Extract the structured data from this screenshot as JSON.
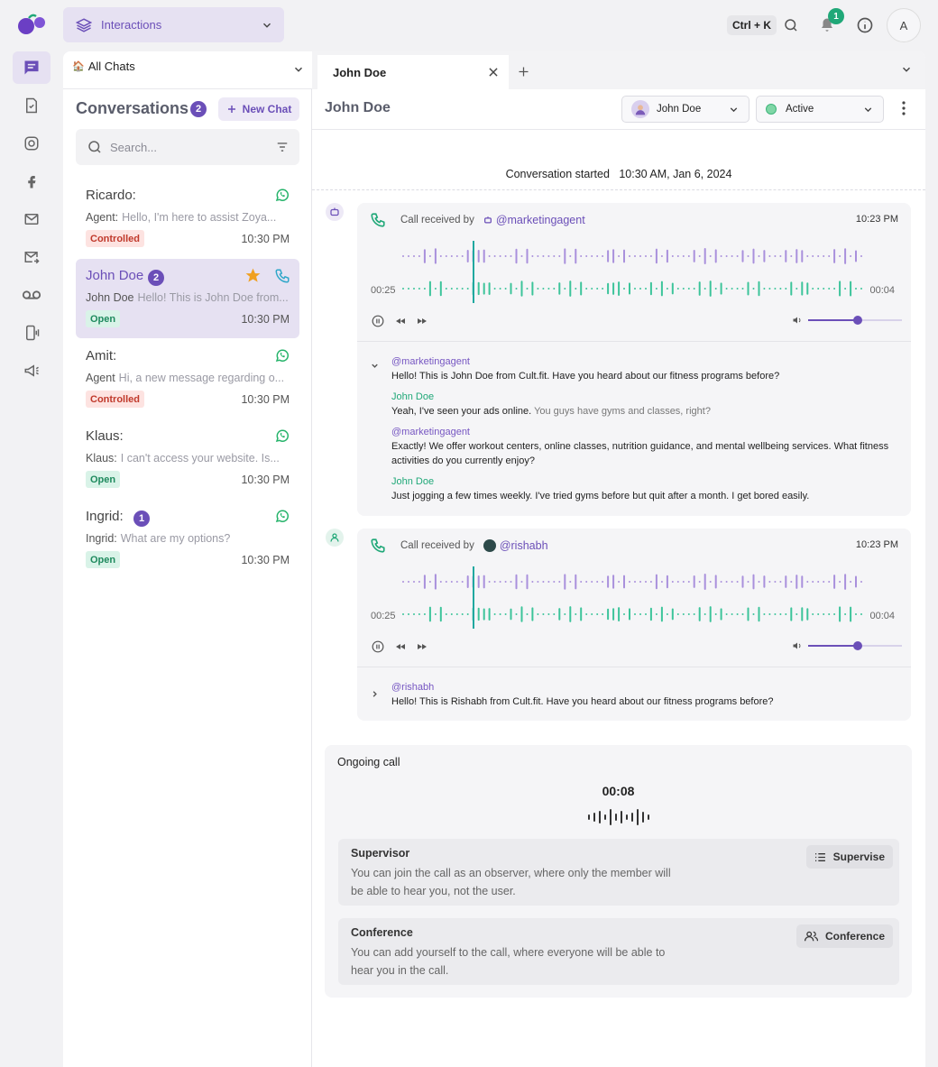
{
  "topbar": {
    "workspace": "Interactions",
    "shortcut": "Ctrl + K",
    "notifications": "1",
    "avatar_initial": "A"
  },
  "sidebar_filter": {
    "label": "All Chats",
    "icon": "house-emoji"
  },
  "conversations": {
    "title": "Conversations",
    "count": "2",
    "new_chat": "New Chat",
    "search_placeholder": "Search...",
    "items": [
      {
        "name": "Ricardo:",
        "sender": "Agent:",
        "preview": "Hello, I'm here to assist Zoya...",
        "tag": "Controlled",
        "time": "10:30 PM",
        "channel": "whatsapp-icon"
      },
      {
        "name": "John Doe",
        "badge": "2",
        "sender": "John Doe",
        "preview": "Hello! This is John Doe from...",
        "tag": "Open",
        "time": "10:30 PM",
        "channel": "phone-icon"
      },
      {
        "name": "Amit:",
        "sender": "Agent",
        "preview": "Hi, a new message regarding o...",
        "tag": "Controlled",
        "time": "10:30 PM",
        "channel": "whatsapp-icon"
      },
      {
        "name": "Klaus:",
        "sender": "Klaus:",
        "preview": "I can't access your website. Is...",
        "tag": "Open",
        "time": "10:30 PM",
        "channel": "whatsapp-icon"
      },
      {
        "name": "Ingrid:",
        "badge": "1",
        "sender": "Ingrid:",
        "preview": "What are my options?",
        "tag": "Open",
        "time": "10:30 PM",
        "channel": "whatsapp-icon"
      }
    ]
  },
  "tabs": [
    {
      "label": "John Doe"
    }
  ],
  "chat": {
    "title": "John Doe",
    "assignee": "John Doe",
    "status": "Active",
    "started_label": "Conversation started",
    "started_time": "10:30 AM, Jan 6, 2024",
    "calls": [
      {
        "received_by": "Call received by",
        "handle": "@marketingagent",
        "time": "10:23 PM",
        "elapsed": "00:25",
        "remaining": "00:04",
        "volume": 0.53,
        "transcript": [
          {
            "speaker": "@marketingagent",
            "text": "Hello! This is John Doe from Cult.fit. Have you heard about our fitness programs before?"
          },
          {
            "speaker": "John Doe",
            "text": "Yeah, I've seen your ads online.",
            "text_dim": "You guys have gyms and classes, right?"
          },
          {
            "speaker": "@marketingagent",
            "text": "Exactly! We offer workout centers, online classes, nutrition guidance, and mental wellbeing services. What fitness activities do you currently enjoy?"
          },
          {
            "speaker": "John Doe",
            "text": "Just jogging a few times weekly. I've tried gyms before but quit after a month. I get bored easily."
          }
        ]
      },
      {
        "received_by": "Call received by",
        "handle": "@rishabh",
        "time": "10:23 PM",
        "elapsed": "00:25",
        "remaining": "00:04",
        "volume": 0.53,
        "transcript": [
          {
            "speaker": "@rishabh",
            "text": "Hello! This is Rishabh from Cult.fit. Have you heard about our fitness programs before?"
          }
        ]
      }
    ],
    "ongoing": {
      "title": "Ongoing call",
      "timer": "00:08",
      "options": [
        {
          "title": "Supervisor",
          "desc": "You can join the call as an observer, where only the member will be able to hear you, not the user.",
          "button": "Supervise"
        },
        {
          "title": "Conference",
          "desc": "You can add yourself to the call, where everyone will be able to hear you in the call.",
          "button": "Conference"
        }
      ]
    }
  }
}
